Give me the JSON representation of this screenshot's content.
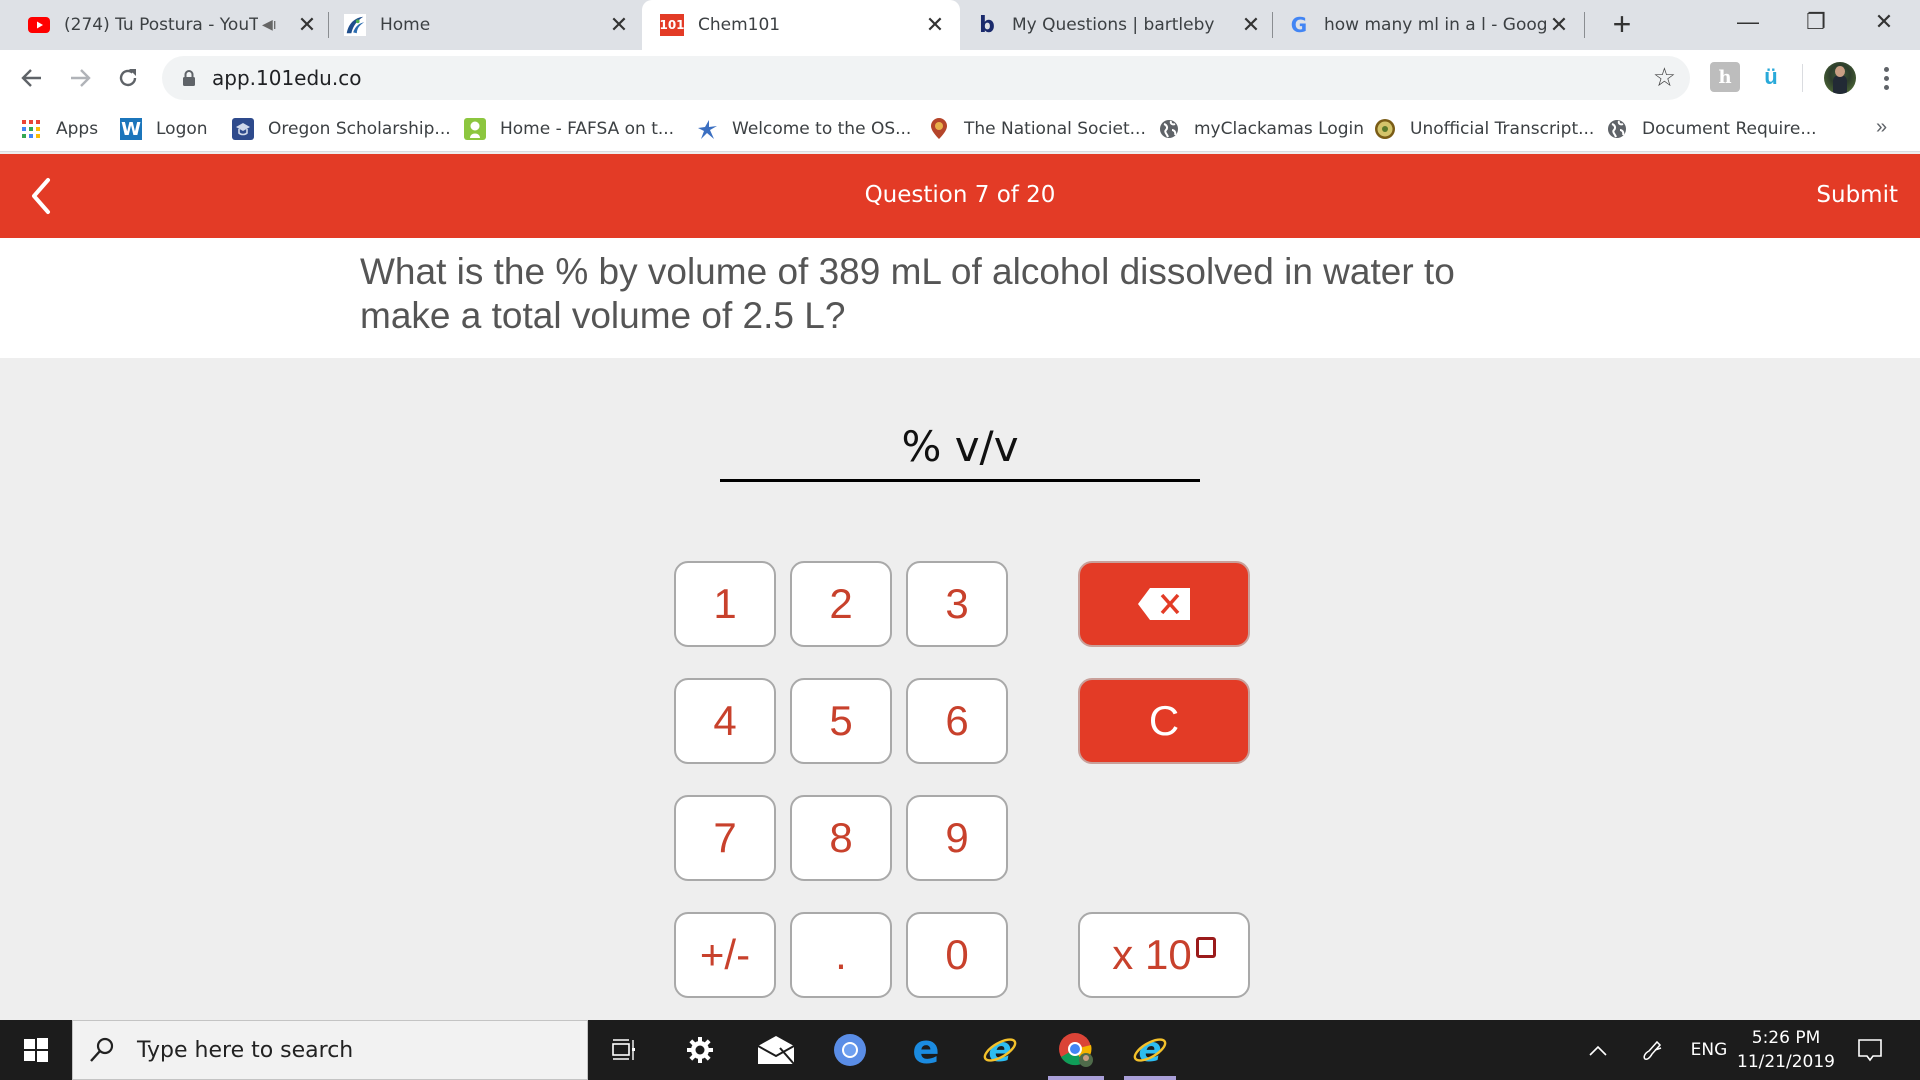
{
  "browser": {
    "tabs": [
      {
        "title": "(274) Tu Postura - YouT",
        "favicon": "youtube-icon",
        "audio": true,
        "active": false
      },
      {
        "title": "Home",
        "favicon": "portal-logo-icon",
        "active": false
      },
      {
        "title": "Chem101",
        "favicon": "chem101-icon",
        "favicon_text": "101",
        "active": true
      },
      {
        "title": "My Questions | bartleby",
        "favicon": "bartleby-icon",
        "favicon_text": "b",
        "active": false
      },
      {
        "title": "how many ml in a l - Googl",
        "favicon": "google-icon",
        "favicon_text": "G",
        "active": false
      }
    ],
    "new_tab_label": "+",
    "window_controls": {
      "minimize": "—",
      "restore": "❐",
      "close": "✕"
    },
    "address": {
      "url": "app.101edu.co",
      "secure": true
    },
    "bookmarks": [
      {
        "label": "Apps",
        "icon": "apps-grid-icon"
      },
      {
        "label": "Logon",
        "icon": "w-logo-icon"
      },
      {
        "label": "Oregon Scholarship...",
        "icon": "scholarship-icon"
      },
      {
        "label": "Home - FAFSA on t...",
        "icon": "fafsa-icon"
      },
      {
        "label": "Welcome to the OS...",
        "icon": "osu-figure-icon"
      },
      {
        "label": "The National Societ...",
        "icon": "national-society-icon"
      },
      {
        "label": "myClackamas Login",
        "icon": "globe-icon"
      },
      {
        "label": "Unofficial Transcript...",
        "icon": "seal-icon"
      },
      {
        "label": "Document Require...",
        "icon": "globe-icon"
      }
    ],
    "bookmarks_overflow": "»"
  },
  "app": {
    "header": {
      "question_counter": "Question 7 of 20",
      "current_question": 7,
      "total_questions": 20,
      "submit_label": "Submit"
    },
    "question": {
      "text": "What is the % by volume of 389 mL of alcohol dissolved in water to make a total volume of 2.5 L?"
    },
    "answer": {
      "value": "",
      "units": "% v/v"
    },
    "keypad": {
      "digits": [
        "1",
        "2",
        "3",
        "4",
        "5",
        "6",
        "7",
        "8",
        "9"
      ],
      "sign_label": "+/-",
      "decimal_label": ".",
      "zero_label": "0",
      "backspace_icon": "backspace-icon",
      "clear_label": "C",
      "sci_label": "x 10"
    },
    "colors": {
      "accent": "#e33b26",
      "key_text": "#c8412c",
      "question_text": "#555555"
    }
  },
  "taskbar": {
    "search_placeholder": "Type here to search",
    "pinned": [
      "task-view-icon",
      "settings-icon",
      "mail-icon",
      "chromium-icon",
      "edge-icon",
      "internet-explorer-icon",
      "chrome-icon",
      "internet-explorer-icon"
    ],
    "tray": {
      "language": "ENG",
      "time": "5:26 PM",
      "date": "11/21/2019"
    }
  }
}
